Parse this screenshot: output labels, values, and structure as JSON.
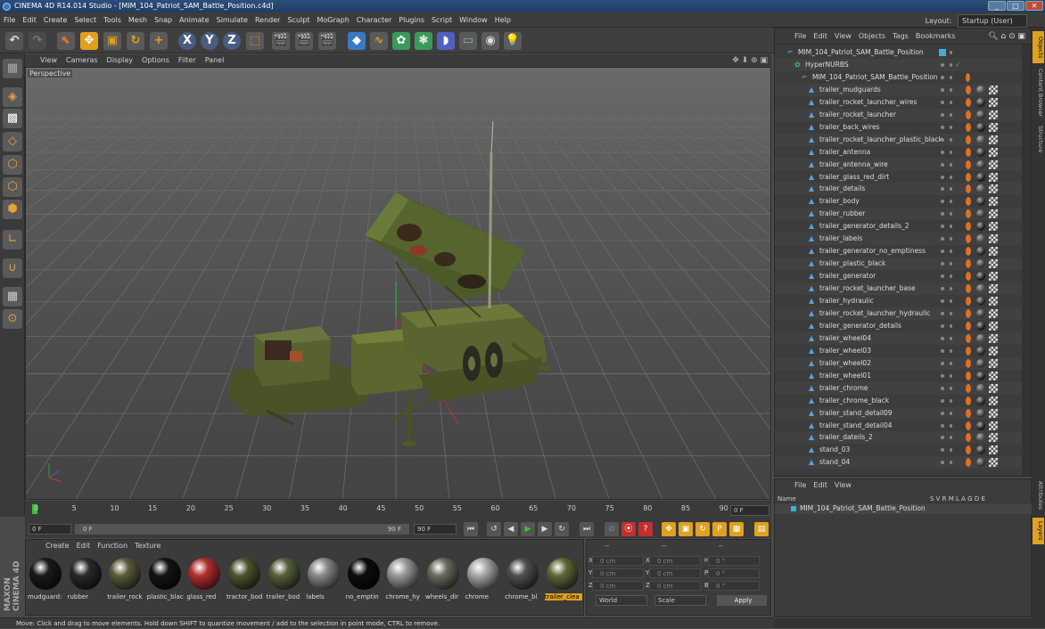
{
  "window": {
    "title": "CINEMA 4D R14.014 Studio - [MIM_104_Patriot_SAM_Battle_Position.c4d]",
    "minimize": "_",
    "maximize": "□",
    "close": "✕"
  },
  "menu": {
    "items": [
      "File",
      "Edit",
      "Create",
      "Select",
      "Tools",
      "Mesh",
      "Snap",
      "Animate",
      "Simulate",
      "Render",
      "Sculpt",
      "MoGraph",
      "Character",
      "Plugins",
      "Script",
      "Window",
      "Help"
    ],
    "layout_label": "Layout:",
    "layout_value": "Startup (User)"
  },
  "viewport": {
    "menu": [
      "View",
      "Cameras",
      "Display",
      "Options",
      "Filter",
      "Panel"
    ],
    "label": "Perspective",
    "nav_icons": "✥ ⬇ ⊕ ▣"
  },
  "timeline": {
    "ticks": [
      "0",
      "5",
      "10",
      "15",
      "20",
      "25",
      "30",
      "35",
      "40",
      "45",
      "50",
      "55",
      "60",
      "65",
      "70",
      "75",
      "80",
      "85",
      "90"
    ],
    "end_field": "0 F"
  },
  "transport": {
    "current_frame": "0 F",
    "start_field": "0 F",
    "end_field": "90 F",
    "max_field": "90 F"
  },
  "materials": {
    "menu": [
      "Create",
      "Edit",
      "Function",
      "Texture"
    ],
    "items": [
      {
        "label": "mudguard:",
        "color": "#1a1a1a"
      },
      {
        "label": "rubber",
        "color": "#2a2a2a"
      },
      {
        "label": "trailer_rock",
        "color": "#5a5c3a"
      },
      {
        "label": "plastic_blac",
        "color": "#141414"
      },
      {
        "label": "glass_red",
        "color": "#b03030"
      },
      {
        "label": "tractor_bod",
        "color": "#4c5530"
      },
      {
        "label": "trailer_bod",
        "color": "#56603a"
      },
      {
        "label": "labels",
        "color": "#888888"
      },
      {
        "label": "no_emptin",
        "color": "#0c0c0c"
      },
      {
        "label": "chrome_hy",
        "color": "#9a9a9a"
      },
      {
        "label": "wheels_dir",
        "color": "#6a6a60"
      },
      {
        "label": "chrome",
        "color": "#a8a8a8"
      },
      {
        "label": "chrome_bl",
        "color": "#505050"
      },
      {
        "label": "trailer_clea",
        "color": "#5e6838"
      }
    ],
    "selected_index": 13
  },
  "coords": {
    "rows": [
      {
        "a": "X",
        "av": "0 cm",
        "b": "X",
        "bv": "0 cm",
        "c": "H",
        "cv": "0 °"
      },
      {
        "a": "Y",
        "av": "0 cm",
        "b": "Y",
        "bv": "0 cm",
        "c": "P",
        "cv": "0 °"
      },
      {
        "a": "Z",
        "av": "0 cm",
        "b": "Z",
        "bv": "0 cm",
        "c": "B",
        "cv": "0 °"
      }
    ],
    "world": "World",
    "scale": "Scale",
    "apply": "Apply",
    "dashes": "--"
  },
  "status": "Move: Click and drag to move elements. Hold down SHIFT to quantize movement / add to the selection in point mode, CTRL to remove.",
  "objects": {
    "menu": [
      "File",
      "Edit",
      "View",
      "Objects",
      "Tags",
      "Bookmarks"
    ],
    "rows": [
      {
        "name": "MIM_104_Patriot_SAM_Battle_Position",
        "indent": 0,
        "type": "null"
      },
      {
        "name": "HyperNURBS",
        "indent": 1,
        "type": "nurbs"
      },
      {
        "name": "MIM_104_Patriot_SAM_Battle_Position",
        "indent": 2,
        "type": "null"
      },
      {
        "name": "trailer_mudguards",
        "indent": 3,
        "type": "mesh"
      },
      {
        "name": "trailer_rocket_launcher_wires",
        "indent": 3,
        "type": "mesh"
      },
      {
        "name": "trailer_rocket_launcher",
        "indent": 3,
        "type": "mesh"
      },
      {
        "name": "trailer_back_wires",
        "indent": 3,
        "type": "mesh"
      },
      {
        "name": "trailer_rocket_launcher_plastic_black",
        "indent": 3,
        "type": "mesh"
      },
      {
        "name": "trailer_antenna",
        "indent": 3,
        "type": "mesh"
      },
      {
        "name": "trailer_antenna_wire",
        "indent": 3,
        "type": "mesh"
      },
      {
        "name": "trailer_glass_red_dirt",
        "indent": 3,
        "type": "mesh"
      },
      {
        "name": "trailer_details",
        "indent": 3,
        "type": "mesh"
      },
      {
        "name": "trailer_body",
        "indent": 3,
        "type": "mesh"
      },
      {
        "name": "trailer_rubber",
        "indent": 3,
        "type": "mesh"
      },
      {
        "name": "trailer_generator_details_2",
        "indent": 3,
        "type": "mesh"
      },
      {
        "name": "trailer_labels",
        "indent": 3,
        "type": "mesh"
      },
      {
        "name": "trailer_generator_no_emptiness",
        "indent": 3,
        "type": "mesh"
      },
      {
        "name": "trailer_plastic_black",
        "indent": 3,
        "type": "mesh"
      },
      {
        "name": "trailer_generator",
        "indent": 3,
        "type": "mesh"
      },
      {
        "name": "trailer_rocket_launcher_base",
        "indent": 3,
        "type": "mesh"
      },
      {
        "name": "trailer_hydraulic",
        "indent": 3,
        "type": "mesh"
      },
      {
        "name": "trailer_rocket_launcher_hydraulic",
        "indent": 3,
        "type": "mesh"
      },
      {
        "name": "trailer_generator_details",
        "indent": 3,
        "type": "mesh"
      },
      {
        "name": "trailer_wheel04",
        "indent": 3,
        "type": "mesh"
      },
      {
        "name": "trailer_wheel03",
        "indent": 3,
        "type": "mesh"
      },
      {
        "name": "trailer_wheel02",
        "indent": 3,
        "type": "mesh"
      },
      {
        "name": "trailer_wheel01",
        "indent": 3,
        "type": "mesh"
      },
      {
        "name": "trailer_chrome",
        "indent": 3,
        "type": "mesh"
      },
      {
        "name": "trailer_chrome_black",
        "indent": 3,
        "type": "mesh"
      },
      {
        "name": "trailer_stand_detail09",
        "indent": 3,
        "type": "mesh"
      },
      {
        "name": "trailer_stand_detail04",
        "indent": 3,
        "type": "mesh"
      },
      {
        "name": "trailer_dateils_2",
        "indent": 3,
        "type": "mesh"
      },
      {
        "name": "stand_03",
        "indent": 3,
        "type": "mesh"
      },
      {
        "name": "stand_04",
        "indent": 3,
        "type": "mesh"
      }
    ]
  },
  "attributes": {
    "menu": [
      "File",
      "Edit",
      "View"
    ],
    "name_header": "Name",
    "cols": "S V R M L A G D E",
    "row": "MIM_104_Patriot_SAM_Battle_Position"
  },
  "sidetabs": [
    "Objects",
    "Content Browser",
    "Structure",
    "Attributes",
    "Layers"
  ],
  "colors": {
    "accent": "#e0a020",
    "selection_blue": "#3a78c9",
    "mesh_icon": "#5aa0e0"
  }
}
